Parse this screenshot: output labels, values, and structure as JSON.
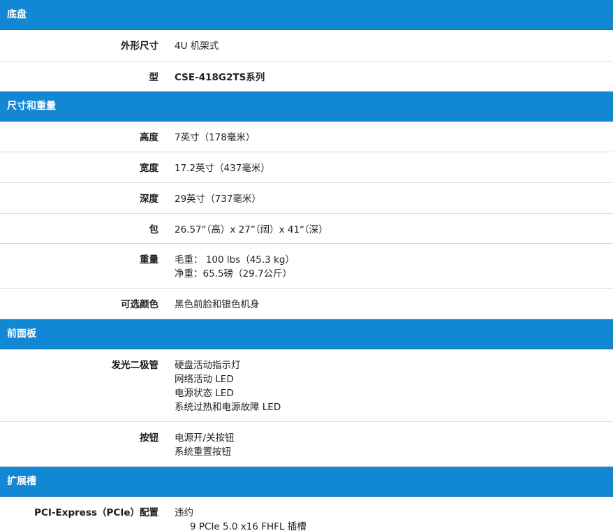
{
  "sections": {
    "chassis": {
      "title": "底盘",
      "form_factor": {
        "label": "外形尺寸",
        "value": "4U 机架式"
      },
      "model": {
        "label": "型",
        "value": "CSE-418G2TS系列"
      }
    },
    "dimensions": {
      "title": "尺寸和重量",
      "height": {
        "label": "高度",
        "value": "7英寸（178毫米）"
      },
      "width": {
        "label": "宽度",
        "value": "17.2英寸（437毫米）"
      },
      "depth": {
        "label": "深度",
        "value": "29英寸（737毫米）"
      },
      "package": {
        "label": "包",
        "value": "26.57“（高）x 27”（阔）x 41“（深）"
      },
      "weight": {
        "label": "重量",
        "lines": [
          "毛重： 100 lbs（45.3 kg）",
          "净重：65.5磅（29.7公斤）"
        ]
      },
      "color": {
        "label": "可选颜色",
        "value": "黑色前脸和银色机身"
      }
    },
    "front_panel": {
      "title": "前面板",
      "leds": {
        "label": "发光二极管",
        "lines": [
          "硬盘活动指示灯",
          "网络活动 LED",
          "电源状态 LED",
          "系统过热和电源故障 LED"
        ]
      },
      "buttons": {
        "label": "按钮",
        "lines": [
          "电源开/关按钮",
          "系统重置按钮"
        ]
      }
    },
    "expansion": {
      "title": "扩展槽",
      "pcie": {
        "label": "PCI-Express（PCIe）配置",
        "lines": [
          "违约",
          "9 PCIe 5.0 x16 FHFL 插槽"
        ]
      }
    }
  }
}
